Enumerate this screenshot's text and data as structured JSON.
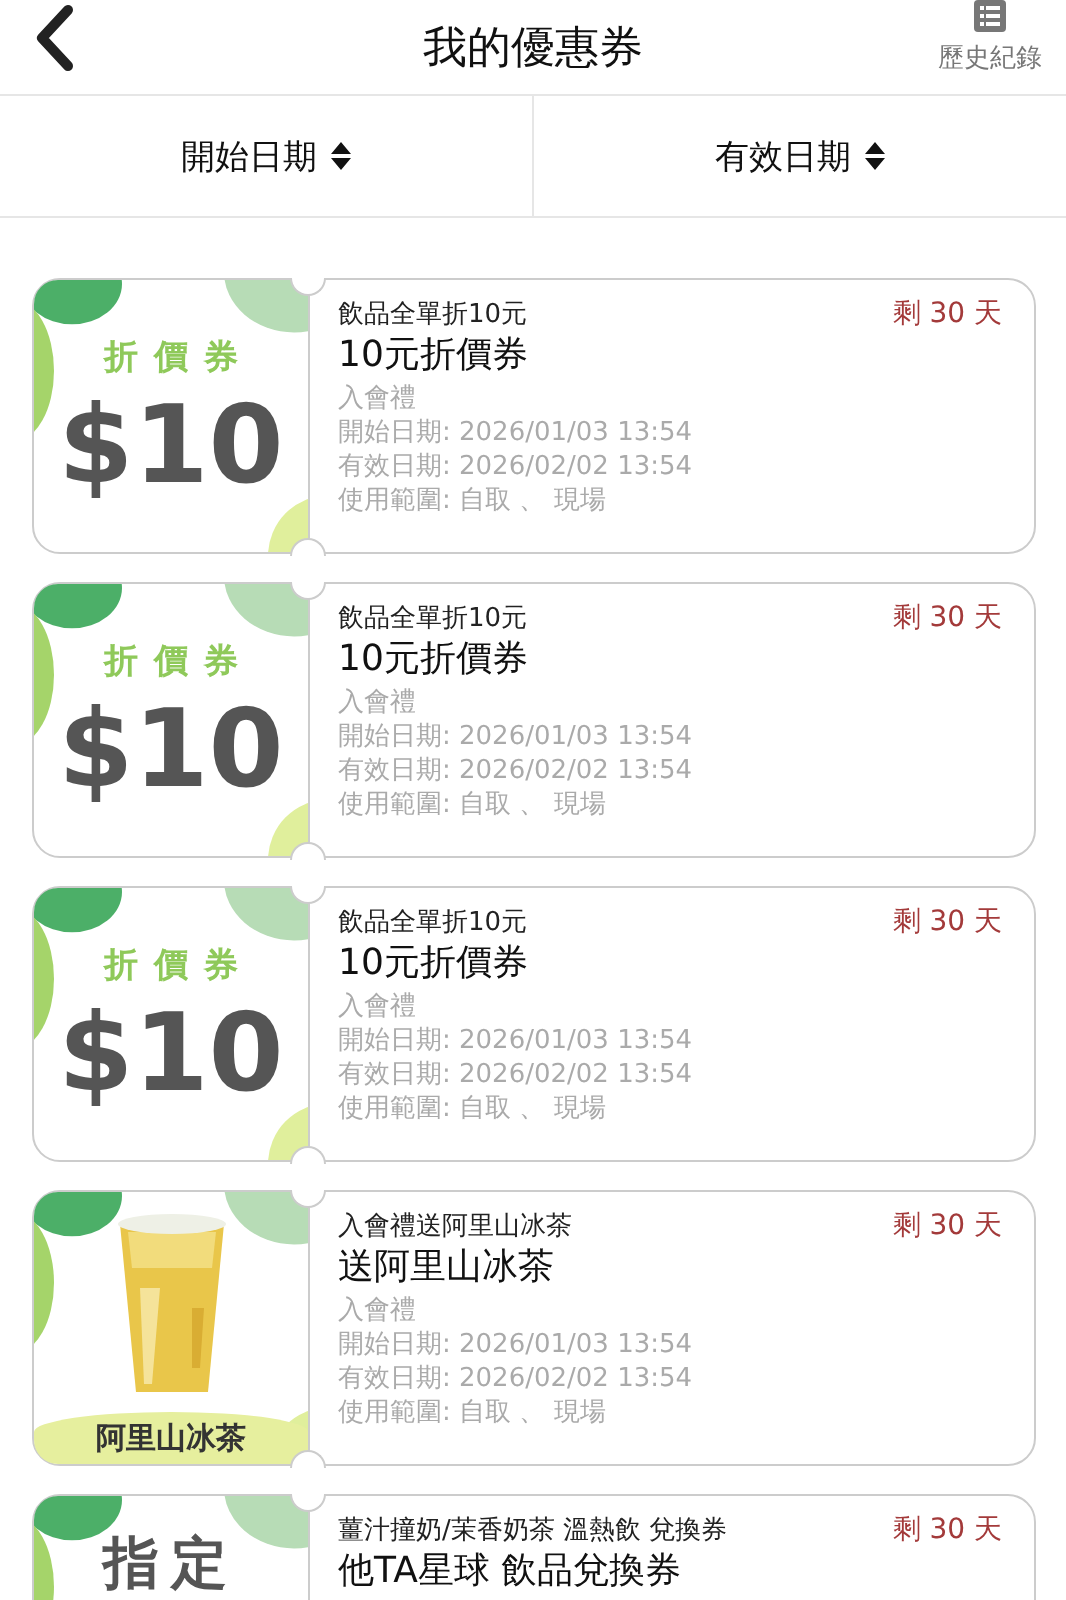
{
  "header": {
    "title": "我的優惠券",
    "history_label": "歷史紀錄"
  },
  "sort_bar": [
    {
      "label": "開始日期"
    },
    {
      "label": "有效日期"
    }
  ],
  "coupons": [
    {
      "badge": {
        "kind": "discount",
        "label": "折價券",
        "amount": "$10"
      },
      "subtitle": "飲品全單折10元",
      "title": "10元折價券",
      "remaining": "剩 30 天",
      "lines": [
        "入會禮",
        "開始日期: 2026/01/03 13:54",
        "有效日期: 2026/02/02 13:54",
        "使用範圍: 自取 、 現場"
      ]
    },
    {
      "badge": {
        "kind": "discount",
        "label": "折價券",
        "amount": "$10"
      },
      "subtitle": "飲品全單折10元",
      "title": "10元折價券",
      "remaining": "剩 30 天",
      "lines": [
        "入會禮",
        "開始日期: 2026/01/03 13:54",
        "有效日期: 2026/02/02 13:54",
        "使用範圍: 自取 、 現場"
      ]
    },
    {
      "badge": {
        "kind": "discount",
        "label": "折價券",
        "amount": "$10"
      },
      "subtitle": "飲品全單折10元",
      "title": "10元折價券",
      "remaining": "剩 30 天",
      "lines": [
        "入會禮",
        "開始日期: 2026/01/03 13:54",
        "有效日期: 2026/02/02 13:54",
        "使用範圍: 自取 、 現場"
      ]
    },
    {
      "badge": {
        "kind": "product",
        "caption": "阿里山冰茶"
      },
      "subtitle": "入會禮送阿里山冰茶",
      "title": "送阿里山冰茶",
      "remaining": "剩 30 天",
      "lines": [
        "入會禮",
        "開始日期: 2026/01/03 13:54",
        "有效日期: 2026/02/02 13:54",
        "使用範圍: 自取 、 現場"
      ]
    },
    {
      "badge": {
        "kind": "designated",
        "label": "指定"
      },
      "subtitle": "薑汁撞奶/茉香奶茶 溫熱飲 兌換券",
      "title": "他TA星球 飲品兌換券",
      "remaining": "剩 30 天"
    }
  ]
}
